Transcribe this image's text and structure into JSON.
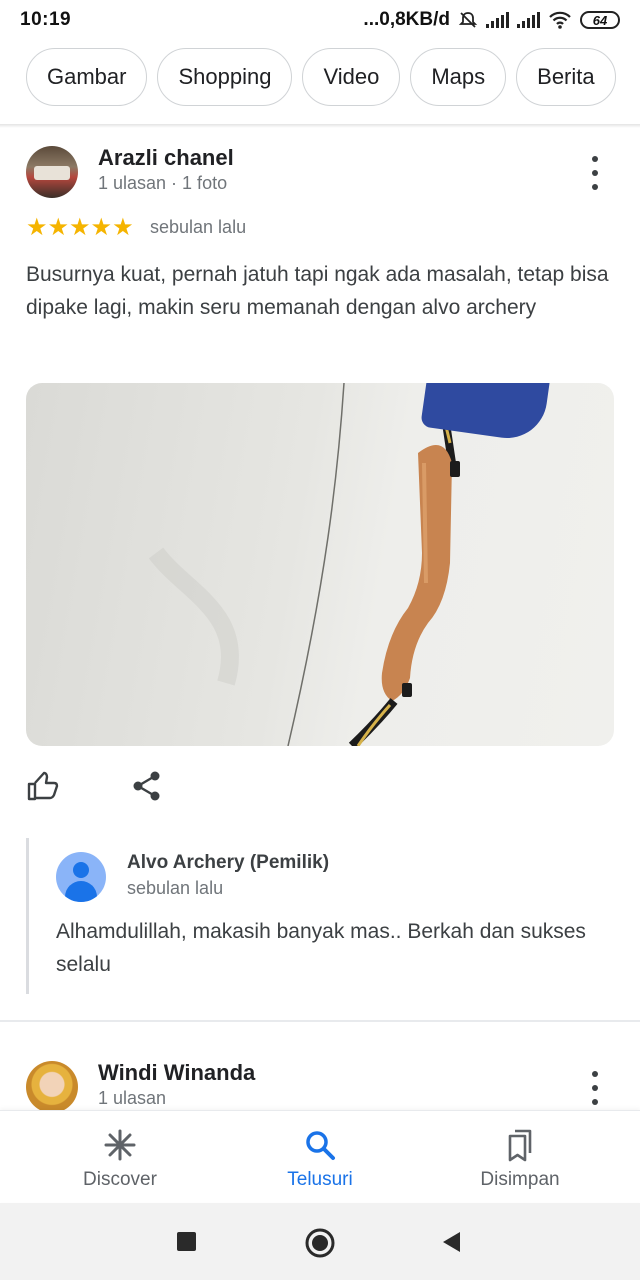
{
  "status_bar": {
    "time": "10:19",
    "network_speed": "...0,8KB/d",
    "battery": "64"
  },
  "chips": [
    "Gambar",
    "Shopping",
    "Video",
    "Maps",
    "Berita"
  ],
  "reviews": [
    {
      "author": "Arazli chanel",
      "meta": "1 ulasan · 1 foto",
      "rating": 5,
      "stars_text": "★★★★★",
      "date": "sebulan lalu",
      "text": "Busurnya kuat, pernah jatuh tapi ngak ada masalah, tetap bisa dipake lagi, makin seru memanah dengan alvo archery",
      "owner_reply": {
        "name": "Alvo Archery (Pemilik)",
        "date": "sebulan lalu",
        "text": "Alhamdulillah, makasih banyak mas.. Berkah dan sukses selalu"
      }
    },
    {
      "author": "Windi Winanda",
      "meta": "1 ulasan"
    }
  ],
  "bottom_nav": [
    {
      "label": "Discover",
      "icon": "asterisk-icon",
      "active": false
    },
    {
      "label": "Telusuri",
      "icon": "search-icon",
      "active": true
    },
    {
      "label": "Disimpan",
      "icon": "bookmarks-icon",
      "active": false
    }
  ],
  "colors": {
    "accent": "#1a73e8",
    "star": "#f5b400",
    "text_secondary": "#70757a"
  }
}
